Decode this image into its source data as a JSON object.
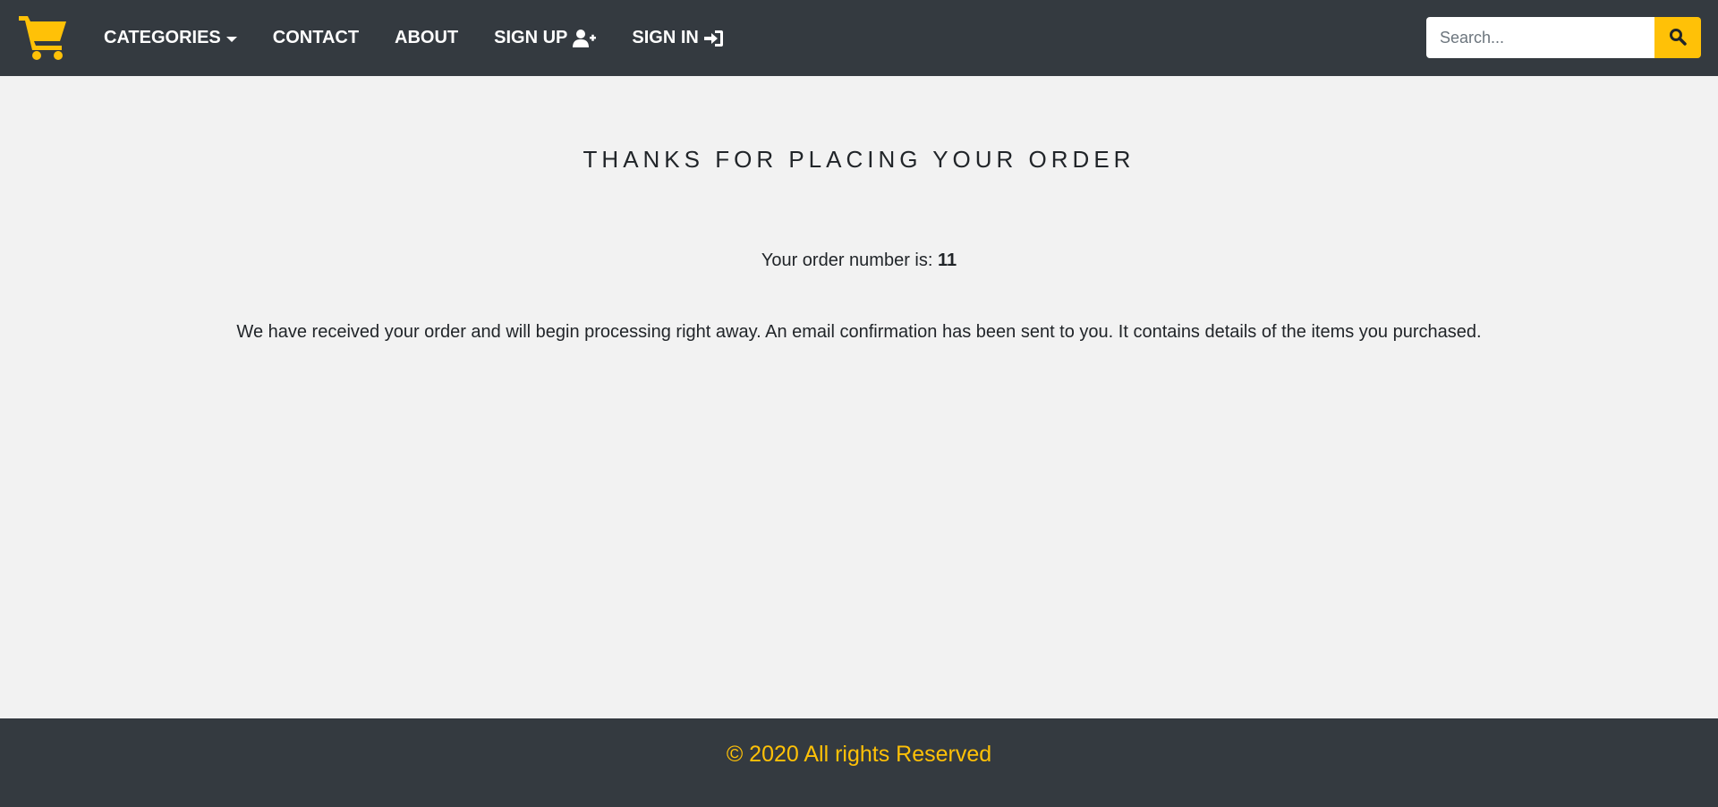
{
  "colors": {
    "navbar_bg": "#343a40",
    "accent": "#ffc107",
    "page_bg": "#f2f2f2",
    "text": "#212529"
  },
  "header": {
    "logo_icon": "shopping-cart-icon",
    "nav": {
      "categories": "CATEGORIES",
      "contact": "CONTACT",
      "about": "ABOUT",
      "sign_up": "SIGN UP",
      "sign_in": "SIGN IN"
    },
    "search": {
      "placeholder": "Search...",
      "value": "",
      "button_icon": "search-icon"
    }
  },
  "main": {
    "title": "THANKS FOR PLACING YOUR ORDER",
    "order_label": "Your order number is: ",
    "order_number": "11",
    "message": "We have received your order and will begin processing right away. An email confirmation has been sent to you. It contains details of the items you purchased."
  },
  "footer": {
    "copyright": "© 2020 All rights Reserved"
  }
}
